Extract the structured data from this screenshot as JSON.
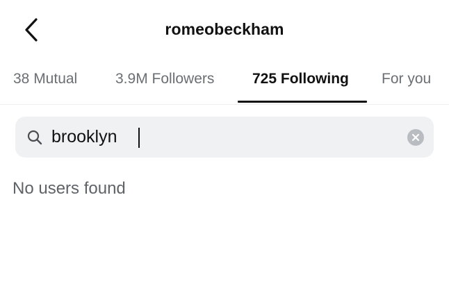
{
  "header": {
    "title": "romeobeckham",
    "back_icon": "chevron-left-icon"
  },
  "tabs": [
    {
      "label": "38 Mutual",
      "active": false
    },
    {
      "label": "3.9M Followers",
      "active": false
    },
    {
      "label": "725 Following",
      "active": true
    },
    {
      "label": "For you",
      "active": false
    }
  ],
  "search": {
    "value": "brooklyn",
    "icon": "search-icon",
    "clear_icon": "clear-icon"
  },
  "results": {
    "empty_message": "No users found"
  },
  "colors": {
    "text_primary": "#111111",
    "text_secondary": "#6b6f74",
    "search_background": "#eff1f3",
    "clear_button": "#b9bcc0",
    "divider": "#efefef"
  }
}
